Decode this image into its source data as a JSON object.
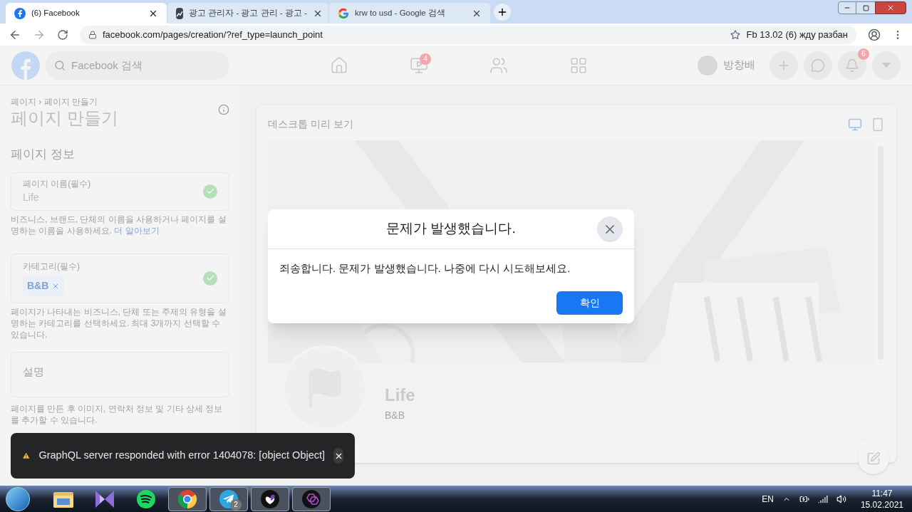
{
  "browser": {
    "tabs": [
      {
        "title": "(6) Facebook",
        "kind": "facebook",
        "selected": true
      },
      {
        "title": "광고 관리자 - 광고 관리 - 광고 -",
        "kind": "ads",
        "selected": false
      },
      {
        "title": "krw to usd - Google 검색",
        "kind": "google",
        "selected": false
      }
    ],
    "url": "facebook.com/pages/creation/?ref_type=launch_point",
    "bookmark": "Fb 13.02 (6) жду разбан"
  },
  "header": {
    "search_placeholder": "Facebook 검색",
    "nav": [
      {
        "kind": "home"
      },
      {
        "kind": "watch",
        "badge": "4"
      },
      {
        "kind": "groups"
      },
      {
        "kind": "gaming"
      }
    ],
    "user_name": "방창배",
    "actions": [
      {
        "kind": "plus"
      },
      {
        "kind": "messenger"
      },
      {
        "kind": "bell",
        "badge": "6"
      },
      {
        "kind": "caret"
      }
    ]
  },
  "form": {
    "breadcrumb": "페이지 › 페이지 만들기",
    "title": "페이지 만들기",
    "section": "페이지 정보",
    "name_field": {
      "label": "페이지 이름(필수)",
      "value": "Life",
      "valid": true
    },
    "name_help": "비즈니스, 브랜드, 단체의 이름을 사용하거나 페이지를 설명하는 이름을 사용하세요.",
    "learn_more": "더 알아보기",
    "category_field": {
      "label": "카테고리(필수)",
      "chips": [
        "B&B"
      ],
      "valid": true
    },
    "category_help": "페이지가 나타내는 비즈니스, 단체 또는 주제의 유형을 설명하는 카테고리를 선택하세요. 최대 3개까지 선택할 수 있습니다.",
    "description_placeholder": "설명",
    "footer_note": "페이지를 만든 후 이미지, 연락처 정보 및 기타 상세 정보를 추가할 수 있습니다."
  },
  "preview": {
    "label": "데스크톱 미리 보기",
    "devices": [
      {
        "kind": "desktop",
        "selected": true
      },
      {
        "kind": "mobile",
        "selected": false
      }
    ],
    "page_name": "Life",
    "category": "B&B"
  },
  "dialog": {
    "title": "문제가 발생했습니다.",
    "message": "죄송합니다. 문제가 발생했습니다. 나중에 다시 시도해보세요.",
    "button": "확인"
  },
  "toast": {
    "message": "GraphQL server responded with error 1404078: [object Object]"
  },
  "taskbar": {
    "apps": [
      {
        "kind": "folder",
        "active": false
      },
      {
        "kind": "studio",
        "active": false
      },
      {
        "kind": "music",
        "active": false
      },
      {
        "kind": "chrome",
        "active": true
      },
      {
        "kind": "telegram",
        "active": true,
        "badge": "2"
      },
      {
        "kind": "viber",
        "active": true
      },
      {
        "kind": "hexagon",
        "active": true
      }
    ],
    "language": "EN",
    "time": "11:47",
    "date": "15.02.2021"
  }
}
